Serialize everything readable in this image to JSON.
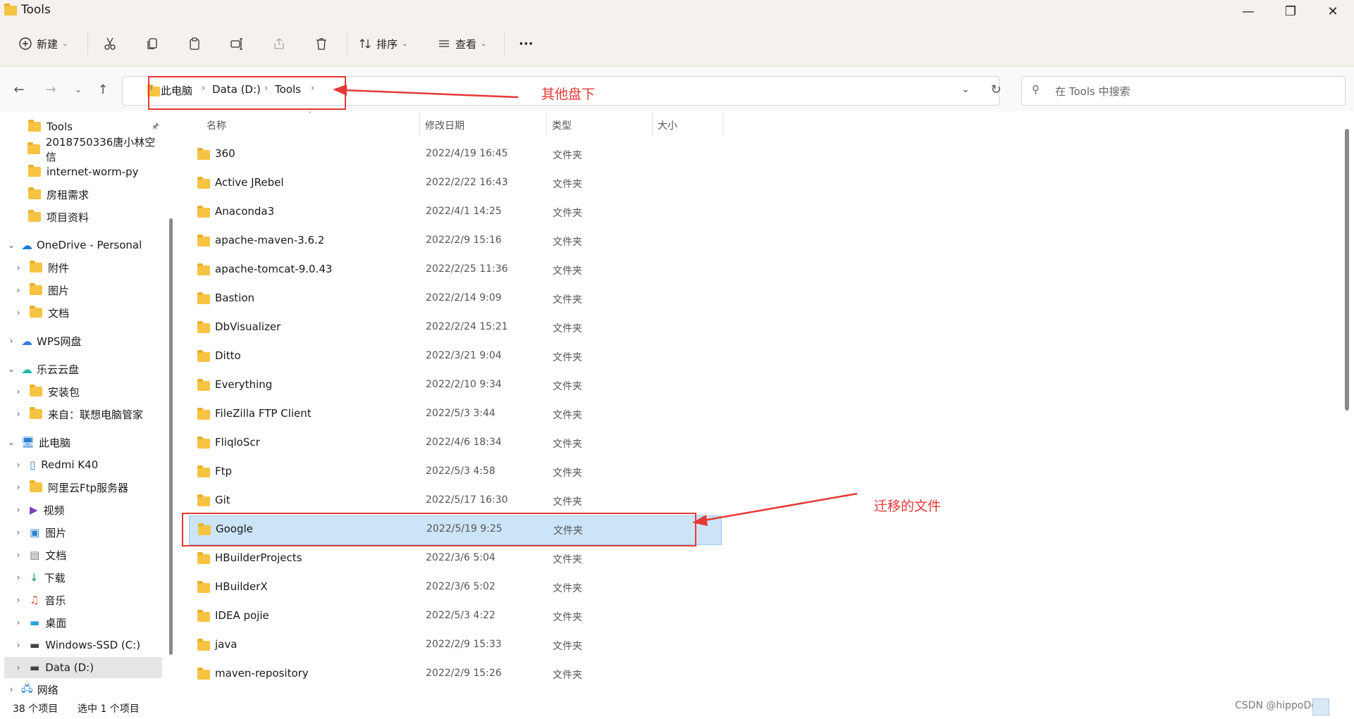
{
  "window": {
    "title": "Tools"
  },
  "toolbar": {
    "new_label": "新建",
    "sort_label": "排序",
    "view_label": "查看",
    "more_label": "···"
  },
  "address": {
    "crumbs": [
      "此电脑",
      "Data (D:)",
      "Tools"
    ]
  },
  "search": {
    "placeholder": "在 Tools 中搜索"
  },
  "sidebar": {
    "quick": [
      "Tools",
      "2018750336唐小林空信",
      "internet-worm-py",
      "房租需求",
      "项目资料"
    ],
    "onedrive": {
      "label": "OneDrive - Personal",
      "children": [
        "附件",
        "图片",
        "文档"
      ]
    },
    "wps": {
      "label": "WPS网盘"
    },
    "leyun": {
      "label": "乐云云盘",
      "children": [
        "安装包",
        "来自：联想电脑管家"
      ]
    },
    "thispc": {
      "label": "此电脑",
      "children": [
        "Redmi K40",
        "阿里云Ftp服务器",
        "视频",
        "图片",
        "文档",
        "下载",
        "音乐",
        "桌面",
        "Windows-SSD (C:)",
        "Data (D:)"
      ]
    },
    "network": {
      "label": "网络"
    }
  },
  "columns": {
    "name": "名称",
    "date": "修改日期",
    "type": "类型",
    "size": "大小"
  },
  "files": [
    {
      "name": "360",
      "date": "2022/4/19 16:45",
      "type": "文件夹"
    },
    {
      "name": "Active JRebel",
      "date": "2022/2/22 16:43",
      "type": "文件夹"
    },
    {
      "name": "Anaconda3",
      "date": "2022/4/1 14:25",
      "type": "文件夹"
    },
    {
      "name": "apache-maven-3.6.2",
      "date": "2022/2/9 15:16",
      "type": "文件夹"
    },
    {
      "name": "apache-tomcat-9.0.43",
      "date": "2022/2/25 11:36",
      "type": "文件夹"
    },
    {
      "name": "Bastion",
      "date": "2022/2/14 9:09",
      "type": "文件夹"
    },
    {
      "name": "DbVisualizer",
      "date": "2022/2/24 15:21",
      "type": "文件夹"
    },
    {
      "name": "Ditto",
      "date": "2022/3/21 9:04",
      "type": "文件夹"
    },
    {
      "name": "Everything",
      "date": "2022/2/10 9:34",
      "type": "文件夹"
    },
    {
      "name": "FileZilla FTP Client",
      "date": "2022/5/3 3:44",
      "type": "文件夹"
    },
    {
      "name": "FliqloScr",
      "date": "2022/4/6 18:34",
      "type": "文件夹"
    },
    {
      "name": "Ftp",
      "date": "2022/5/3 4:58",
      "type": "文件夹"
    },
    {
      "name": "Git",
      "date": "2022/5/17 16:30",
      "type": "文件夹"
    },
    {
      "name": "Google",
      "date": "2022/5/19 9:25",
      "type": "文件夹",
      "selected": true
    },
    {
      "name": "HBuilderProjects",
      "date": "2022/3/6 5:04",
      "type": "文件夹"
    },
    {
      "name": "HBuilderX",
      "date": "2022/3/6 5:02",
      "type": "文件夹"
    },
    {
      "name": "IDEA pojie",
      "date": "2022/5/3 4:22",
      "type": "文件夹"
    },
    {
      "name": "java",
      "date": "2022/2/9 15:33",
      "type": "文件夹"
    },
    {
      "name": "maven-repository",
      "date": "2022/2/9 15:26",
      "type": "文件夹"
    }
  ],
  "status": {
    "count": "38 个项目",
    "selected": "选中 1 个项目"
  },
  "annotations": {
    "other_drive": "其他盘下",
    "moved_file": "迁移的文件"
  },
  "watermark": "CSDN @hippoDesk",
  "colors": {
    "accent": "#0067c0",
    "selection": "#cce4f7",
    "annotation": "#e53935",
    "folder": "#f6c343"
  }
}
